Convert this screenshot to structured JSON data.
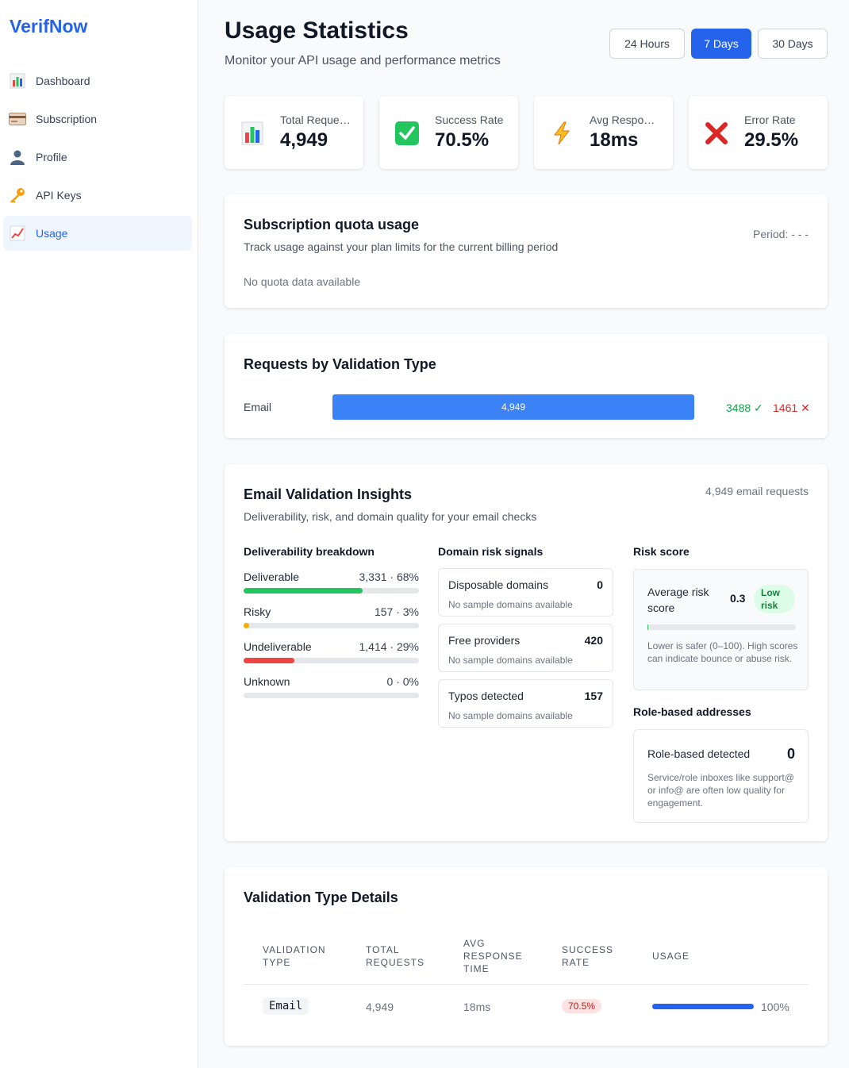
{
  "brand": "VerifNow",
  "nav": [
    {
      "label": "Dashboard",
      "icon": "bar-chart-icon"
    },
    {
      "label": "Subscription",
      "icon": "credit-card-icon"
    },
    {
      "label": "Profile",
      "icon": "user-icon"
    },
    {
      "label": "API Keys",
      "icon": "key-icon"
    },
    {
      "label": "Usage",
      "icon": "trend-chart-icon",
      "active": true
    }
  ],
  "header": {
    "title": "Usage Statistics",
    "subtitle": "Monitor your API usage and performance metrics",
    "ranges": [
      "24 Hours",
      "7 Days",
      "30 Days"
    ],
    "active_range": "7 Days"
  },
  "stats": [
    {
      "label": "Total Requests",
      "value": "4,949",
      "icon": "bar-chart-icon"
    },
    {
      "label": "Success Rate",
      "value": "70.5%",
      "icon": "check-box-icon"
    },
    {
      "label": "Avg Response Time",
      "value": "18ms",
      "icon": "lightning-icon"
    },
    {
      "label": "Error Rate",
      "value": "29.5%",
      "icon": "cross-icon"
    }
  ],
  "quota": {
    "title": "Subscription quota usage",
    "subtitle": "Track usage against your plan limits for the current billing period",
    "period": "Period: - - -",
    "empty": "No quota data available"
  },
  "by_type": {
    "title": "Requests by Validation Type",
    "rows": [
      {
        "label": "Email",
        "total": "4,949",
        "share": 1.0,
        "success": "3488 ✓",
        "errors": "1461 ✕"
      }
    ]
  },
  "insights": {
    "title": "Email Validation Insights",
    "subtitle": "Deliverability, risk, and domain quality for your email checks",
    "count": "4,949 email requests",
    "deliverability": {
      "title": "Deliverability breakdown",
      "rows": [
        {
          "label": "Deliverable",
          "value": "3,331 · 68%",
          "fraction": 0.68,
          "color": "#22c55e"
        },
        {
          "label": "Risky",
          "value": "157 · 3%",
          "fraction": 0.03,
          "color": "#eab308"
        },
        {
          "label": "Undeliverable",
          "value": "1,414 · 29%",
          "fraction": 0.29,
          "color": "#ef4444"
        },
        {
          "label": "Unknown",
          "value": "0 · 0%",
          "fraction": 0.0,
          "color": "#9ca3af"
        }
      ]
    },
    "domain": {
      "title": "Domain risk signals",
      "rows": [
        {
          "label": "Disposable domains",
          "value": "0",
          "note": "No sample domains available"
        },
        {
          "label": "Free providers",
          "value": "420",
          "note": "No sample domains available"
        },
        {
          "label": "Typos detected",
          "value": "157",
          "note": "No sample domains available"
        }
      ]
    },
    "risk": {
      "title": "Risk score",
      "label": "Average risk score",
      "value": "0.3",
      "badge": "Low risk",
      "fraction": 0.003,
      "note": "Lower is safer (0–100). High scores can indicate bounce or abuse risk."
    },
    "role": {
      "title": "Role-based addresses",
      "label": "Role-based detected",
      "value": "0",
      "note": "Service/role inboxes like support@ or info@ are often low quality for engagement."
    }
  },
  "details": {
    "title": "Validation Type Details",
    "headers": [
      "Validation Type",
      "Total Requests",
      "Avg Response Time",
      "Success Rate",
      "Usage"
    ],
    "rows": [
      {
        "type": "Email",
        "total": "4,949",
        "avg": "18ms",
        "success": "70.5%",
        "usage": "100%",
        "usage_fraction": 1.0
      }
    ]
  }
}
